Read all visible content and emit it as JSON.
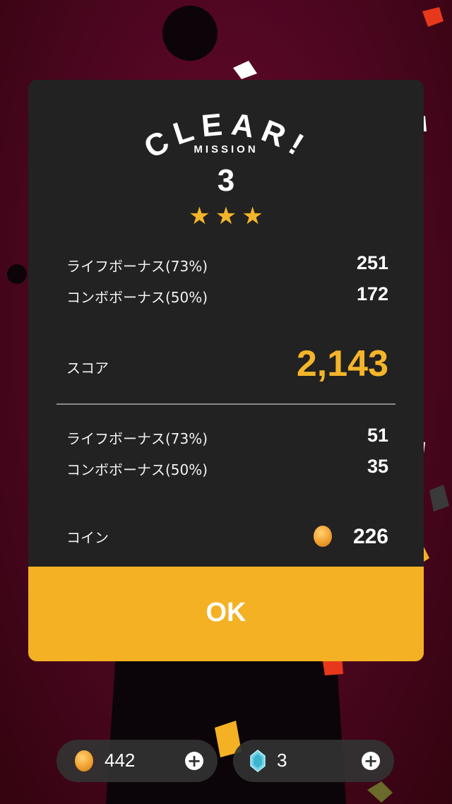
{
  "result": {
    "title": "CLEAR!",
    "mission_label": "MISSION",
    "mission_number": "3",
    "stars_earned": 3,
    "stars_total": 3,
    "score_section": {
      "rows": [
        {
          "label": "ライフボーナス(73%)",
          "value": "251"
        },
        {
          "label": "コンボボーナス(50%)",
          "value": "172"
        }
      ],
      "total_label": "スコア",
      "total_value": "2,143"
    },
    "coin_section": {
      "rows": [
        {
          "label": "ライフボーナス(73%)",
          "value": "51"
        },
        {
          "label": "コンボボーナス(50%)",
          "value": "35"
        }
      ],
      "total_label": "コイン",
      "total_value": "226"
    },
    "ok_label": "OK"
  },
  "wallet": {
    "coins": "442",
    "gems": "3"
  },
  "colors": {
    "accent": "#f4b124",
    "card": "#222222",
    "background": "#4c0620"
  },
  "icons": {
    "star": "star-icon",
    "coin": "coin-icon",
    "gem": "gem-icon",
    "plus": "plus-icon"
  }
}
